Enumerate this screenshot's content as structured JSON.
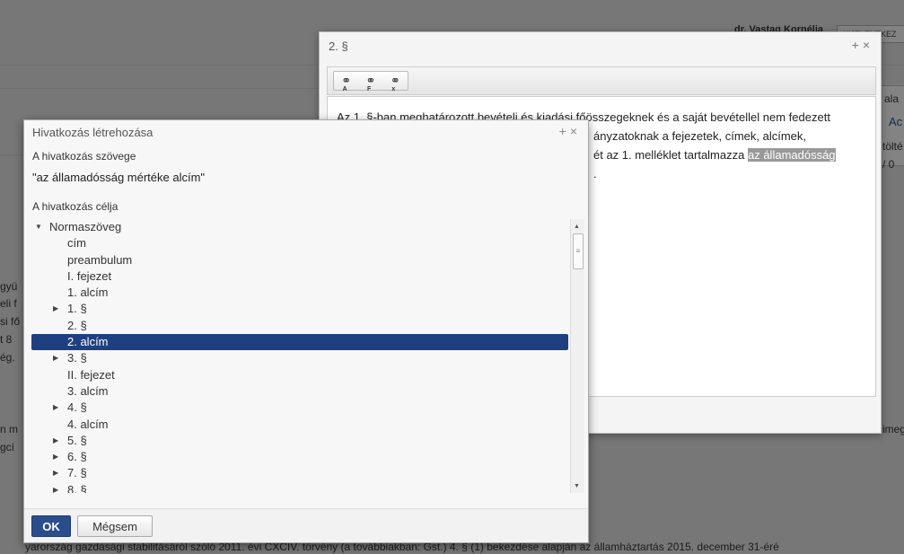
{
  "background": {
    "user_name": "dr. Vastag Kornélia",
    "user_button": "KIJELENTKEZ",
    "right_fragments": [
      "ala",
      "Ac",
      "tölté",
      "/ 0"
    ],
    "left_fragments": [
      "gyü",
      "eli f",
      "si fő",
      "t 8",
      "ég.",
      "n m",
      "gcí"
    ],
    "right_fragment_bottom": "imeg",
    "bottom_text": "yarország gazdasági stabilitásáról szóló 2011. évi CXCIV. törvény (a továbbiakban: Gst.) 4. § (1) bekezdése alapján az államháztartás 2015. december 31-éré"
  },
  "section_dialog": {
    "title": "2. §",
    "controls": "+ ×",
    "editor_lines": [
      "Az 1. §-ban meghatározott bevételi és kiadási főösszegeknek és a saját bevétellel nem fedezett",
      "ányzatoknak a fejezetek, címek, alcímek,",
      "ét az 1. melléklet tartalmazza"
    ],
    "highlight": "az államadósság",
    "period": "."
  },
  "link_dialog": {
    "title": "Hivatkozás létrehozása",
    "controls": "+ ×",
    "text_label": "A hivatkozás szövege",
    "text_value": "\"az államadósság mértéke alcím\"",
    "target_label": "A hivatkozás célja",
    "tree": [
      {
        "label": "Normaszöveg",
        "level": 0,
        "arrow": "▼"
      },
      {
        "label": "cím",
        "level": 1,
        "arrow": ""
      },
      {
        "label": "preambulum",
        "level": 1,
        "arrow": ""
      },
      {
        "label": "I. fejezet",
        "level": 1,
        "arrow": ""
      },
      {
        "label": "1. alcím",
        "level": 1,
        "arrow": ""
      },
      {
        "label": "1. §",
        "level": 1,
        "arrow": "▶"
      },
      {
        "label": "2. §",
        "level": 1,
        "arrow": ""
      },
      {
        "label": "2. alcím",
        "level": 1,
        "arrow": "",
        "selected": true
      },
      {
        "label": "3. §",
        "level": 1,
        "arrow": "▶"
      },
      {
        "label": "II. fejezet",
        "level": 1,
        "arrow": ""
      },
      {
        "label": "3. alcím",
        "level": 1,
        "arrow": ""
      },
      {
        "label": "4. §",
        "level": 1,
        "arrow": "▶"
      },
      {
        "label": "4. alcím",
        "level": 1,
        "arrow": ""
      },
      {
        "label": "5. §",
        "level": 1,
        "arrow": "▶"
      },
      {
        "label": "6. §",
        "level": 1,
        "arrow": "▶"
      },
      {
        "label": "7. §",
        "level": 1,
        "arrow": "▶"
      },
      {
        "label": "8. §",
        "level": 1,
        "arrow": "▶"
      }
    ],
    "ok_label": "OK",
    "cancel_label": "Mégsem"
  },
  "colors": {
    "selected_row": "#1f4080",
    "ok_button": "#2a4e8c",
    "overlay": "#7a7a7a"
  }
}
